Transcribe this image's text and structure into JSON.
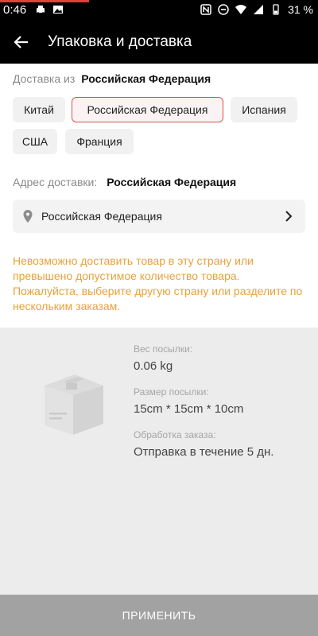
{
  "status_bar": {
    "time": "0:46",
    "battery": "31 %"
  },
  "app_bar": {
    "title": "Упаковка и доставка"
  },
  "ship_from": {
    "label": "Доставка из",
    "value": "Российская Федерация",
    "options": [
      {
        "label": "Китай",
        "selected": false
      },
      {
        "label": "Российская Федерация",
        "selected": true
      },
      {
        "label": "Испания",
        "selected": false
      },
      {
        "label": "США",
        "selected": false
      },
      {
        "label": "Франция",
        "selected": false
      }
    ]
  },
  "delivery_address": {
    "label": "Адрес доставки:",
    "value": "Российская Федерация",
    "selector_value": "Российская Федерация"
  },
  "warning_text": "Невозможно доставить товар в эту страну или превышено допустимое количество товара. Пожалуйста, выберите другую страну или разделите по нескольким заказам.",
  "package": {
    "weight_label": "Вес посылки:",
    "weight_value": "0.06 kg",
    "size_label": "Размер посылки:",
    "size_value": "15cm * 15cm * 10cm",
    "processing_label": "Обработка заказа:",
    "processing_value": "Отправка в течение 5 дн."
  },
  "apply_button": "ПРИМЕНИТЬ",
  "colors": {
    "selected_border": "#d9534f",
    "warning": "#e8a23a",
    "apply_bg": "#a2a2a2"
  }
}
